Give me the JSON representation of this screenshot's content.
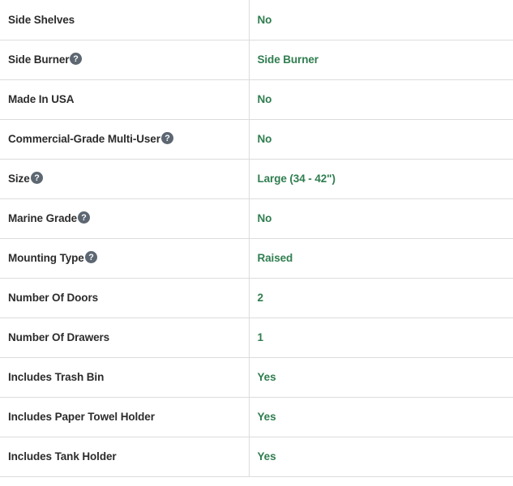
{
  "table": {
    "name": "product-specifications",
    "accent_value_color": "#2f7d4f",
    "label_color": "#2c2c2c",
    "divider_color": "#dcdcdc",
    "help_icon_color": "#5d6772",
    "help_icon_name": "help-circle-icon",
    "rows": [
      {
        "label": "Side Shelves",
        "has_help": false,
        "value": "No"
      },
      {
        "label": "Side Burner",
        "has_help": true,
        "value": "Side Burner"
      },
      {
        "label": "Made In USA",
        "has_help": false,
        "value": "No"
      },
      {
        "label": "Commercial-Grade Multi-User",
        "has_help": true,
        "value": "No"
      },
      {
        "label": "Size",
        "has_help": true,
        "value": "Large (34 - 42\")"
      },
      {
        "label": "Marine Grade",
        "has_help": true,
        "value": "No"
      },
      {
        "label": "Mounting Type",
        "has_help": true,
        "value": "Raised"
      },
      {
        "label": "Number Of Doors",
        "has_help": false,
        "value": "2"
      },
      {
        "label": "Number Of Drawers",
        "has_help": false,
        "value": "1"
      },
      {
        "label": "Includes Trash Bin",
        "has_help": false,
        "value": "Yes"
      },
      {
        "label": "Includes Paper Towel Holder",
        "has_help": false,
        "value": "Yes"
      },
      {
        "label": "Includes Tank Holder",
        "has_help": false,
        "value": "Yes"
      }
    ]
  }
}
